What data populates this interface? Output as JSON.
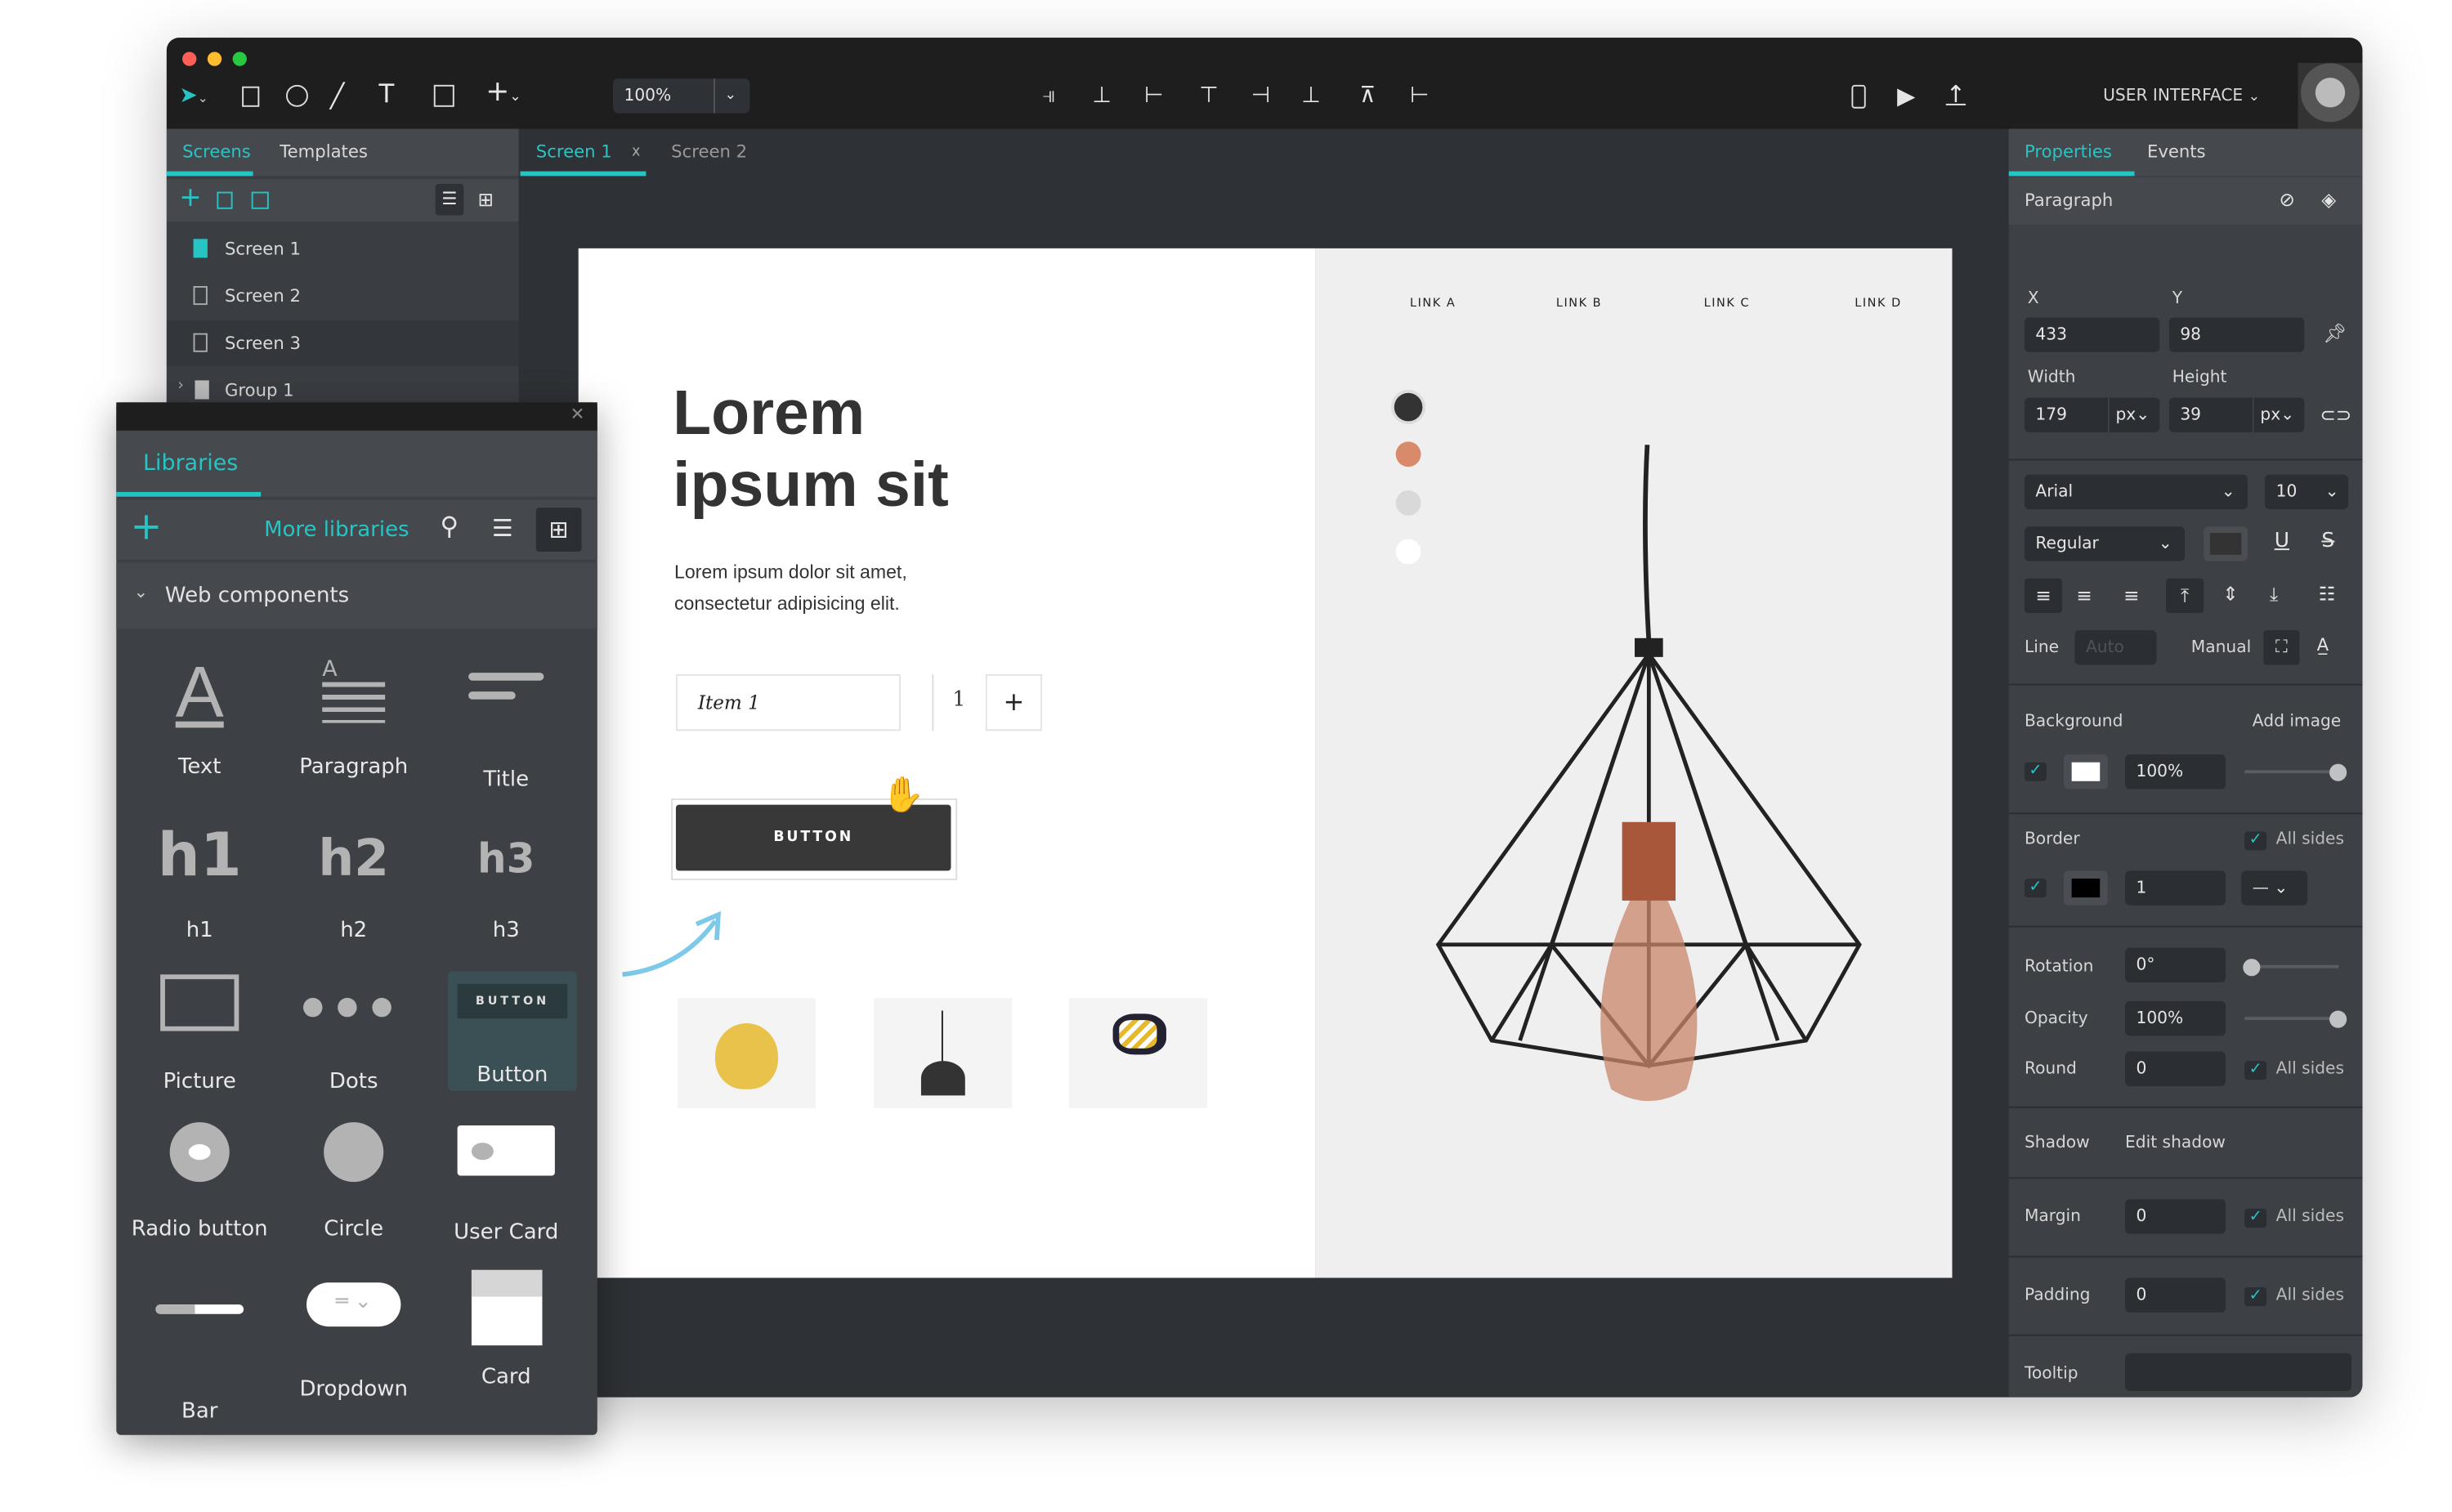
{
  "window": {
    "traffic_colors": [
      "#ff5f57",
      "#febc2e",
      "#28c840"
    ]
  },
  "toolbar": {
    "tools": [
      "select-tool",
      "rectangle-tool",
      "ellipse-tool",
      "line-tool",
      "text-tool",
      "image-tool",
      "add-tool"
    ],
    "zoom": "100%",
    "align_tools": [
      "align-right",
      "align-center-horizontal",
      "align-left",
      "align-top",
      "align-middle",
      "align-bottom",
      "distribute-vertical",
      "distribute-horizontal"
    ],
    "project_menu": "USER INTERFACE"
  },
  "left_panel": {
    "tabs": [
      "Screens",
      "Templates"
    ],
    "active_tab": "Screens",
    "items": [
      {
        "label": "Screen 1",
        "active": true
      },
      {
        "label": "Screen 2"
      },
      {
        "label": "Screen 3"
      },
      {
        "label": "Group 1",
        "type": "folder"
      }
    ]
  },
  "canvas_tabs": [
    {
      "label": "Screen 1",
      "active": true,
      "close": "x"
    },
    {
      "label": "Screen 2"
    }
  ],
  "artboard": {
    "title_line1": "Lorem",
    "title_line2": "ipsum sit",
    "paragraph_line1": "Lorem ipsum dolor sit amet,",
    "paragraph_line2": "consectetur adipisicing elit.",
    "select_value": "Item 1",
    "quantity": "1",
    "plus": "+",
    "button_label": "BUTTON",
    "nav_links": [
      "LINK A",
      "LINK B",
      "LINK C",
      "LINK D"
    ],
    "swatches": [
      "#333333",
      "#d88a6a",
      "#d9d9d9",
      "#ffffff"
    ]
  },
  "libraries": {
    "tab": "Libraries",
    "more": "More libraries",
    "section": "Web components",
    "items": [
      "Text",
      "Paragraph",
      "Title",
      "h1",
      "h2",
      "h3",
      "Picture",
      "Dots",
      "Button",
      "Radio button",
      "Circle",
      "User Card",
      "Bar",
      "Dropdown",
      "Card"
    ],
    "glyphs": {
      "h1": "h1",
      "h2": "h2",
      "h3": "h3",
      "button": "BUTTON",
      "text": "A"
    }
  },
  "properties": {
    "tabs": [
      "Properties",
      "Events"
    ],
    "active_tab": "Properties",
    "element": "Paragraph",
    "x_label": "X",
    "y_label": "Y",
    "x": "433",
    "y": "98",
    "width_label": "Width",
    "height_label": "Height",
    "width": "179",
    "height": "39",
    "unit": "px",
    "font": "Arial",
    "font_size": "10",
    "weight": "Regular",
    "line_label": "Line",
    "line_placeholder": "Auto",
    "manual": "Manual",
    "background_label": "Background",
    "add_image": "Add image",
    "bg_opacity": "100%",
    "bg_opacity_value": 100,
    "border_label": "Border",
    "all_sides": "All sides",
    "border_width": "1",
    "rotation_label": "Rotation",
    "rotation": "0°",
    "rotation_value": 0,
    "opacity_label": "Opacity",
    "opacity": "100%",
    "opacity_value": 100,
    "round_label": "Round",
    "round": "0",
    "shadow_label": "Shadow",
    "edit_shadow": "Edit shadow",
    "margin_label": "Margin",
    "margin": "0",
    "padding_label": "Padding",
    "padding": "0",
    "tooltip_label": "Tooltip",
    "accent": "#27c4c4"
  }
}
